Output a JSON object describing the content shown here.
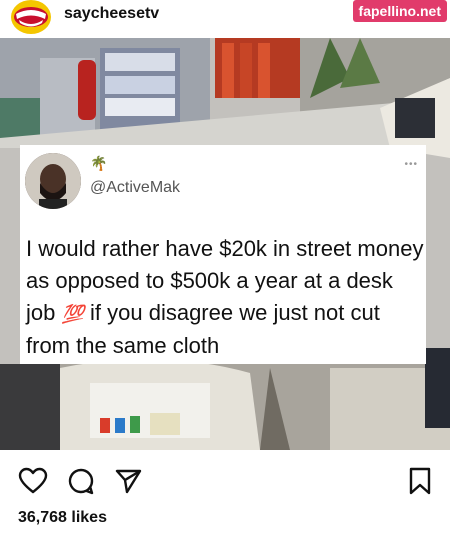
{
  "header": {
    "username": "saycheesetv",
    "watermark": "fapellino.net"
  },
  "tweet": {
    "palm_emoji": "🌴",
    "handle": "@ActiveMak",
    "more_label": "•••",
    "text_before": "I would rather have $20k in street money as opposed to $500k a year at a desk job ",
    "emoji": "💯",
    "text_after": " if you disagree we just not cut from the same cloth"
  },
  "actions": {
    "like_icon": "heart-icon",
    "comment_icon": "comment-icon",
    "share_icon": "send-icon",
    "save_icon": "bookmark-icon"
  },
  "likes": "36,768 likes",
  "colors": {
    "watermark_bg": "#e13b6b",
    "avatar_bg": "#f4c600"
  }
}
